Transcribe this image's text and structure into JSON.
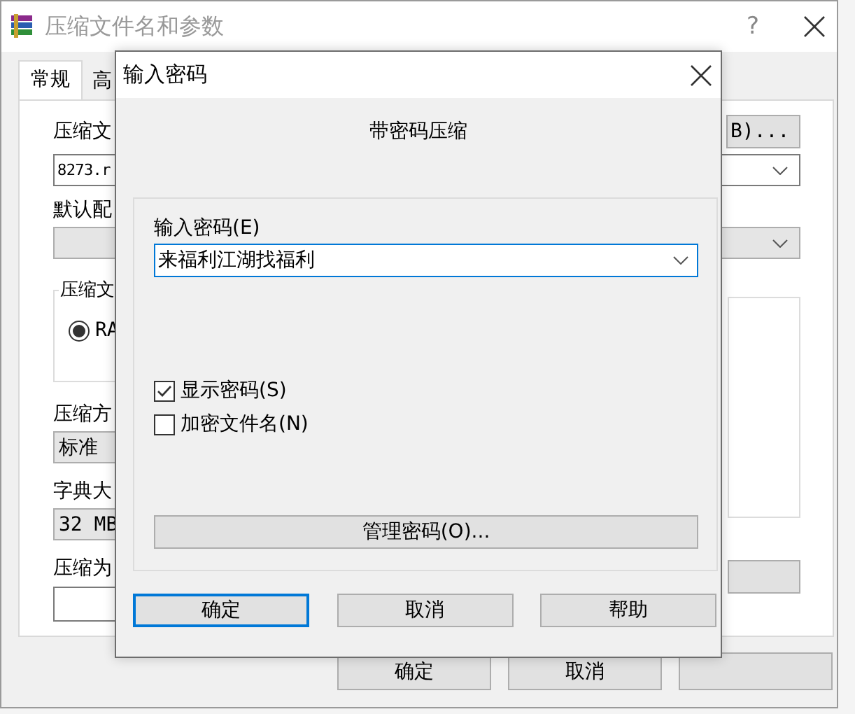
{
  "background_window": {
    "title": "压缩文件名和参数",
    "help_button": "?",
    "tabs": [
      {
        "label": "常规",
        "selected": true
      },
      {
        "label": "高",
        "selected": false
      }
    ],
    "archive_name_label": "压缩文",
    "browse_button": "B)...",
    "archive_name_value": "8273.r",
    "profile_label": "默认配",
    "format_group": {
      "legend": "压缩文",
      "options": [
        {
          "label": "RA",
          "selected": true
        }
      ]
    },
    "method_label": "压缩方",
    "method_value": "标准",
    "dictionary_label": "字典大",
    "dictionary_value": "32 MB",
    "split_label": "压缩为",
    "buttons": [
      "确定",
      "取消"
    ]
  },
  "dialog": {
    "title": "输入密码",
    "heading": "带密码压缩",
    "password_label": "输入密码(E)",
    "password_value": "来福利江湖找福利",
    "checkboxes": [
      {
        "label": "显示密码(S)",
        "checked": true
      },
      {
        "label": "加密文件名(N)",
        "checked": false
      }
    ],
    "manage_button": "管理密码(O)...",
    "buttons": [
      {
        "label": "确定",
        "focused": true
      },
      {
        "label": "取消",
        "focused": false
      },
      {
        "label": "帮助",
        "focused": false
      }
    ]
  }
}
